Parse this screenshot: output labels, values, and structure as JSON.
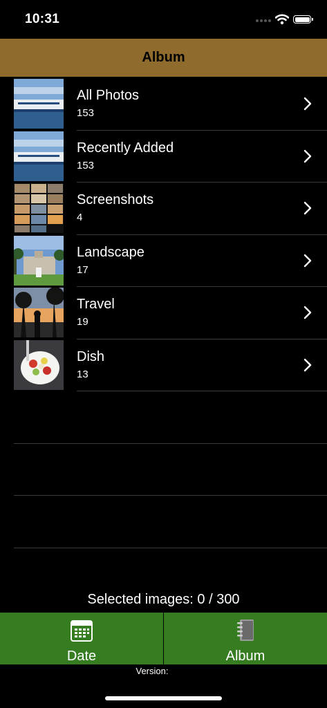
{
  "status_bar": {
    "time": "10:31"
  },
  "nav": {
    "title": "Album"
  },
  "albums": [
    {
      "title": "All Photos",
      "count": "153",
      "thumb": "harbor-boat"
    },
    {
      "title": "Recently Added",
      "count": "153",
      "thumb": "harbor-boat"
    },
    {
      "title": "Screenshots",
      "count": "4",
      "thumb": "collage"
    },
    {
      "title": "Landscape",
      "count": "17",
      "thumb": "palace-lawn"
    },
    {
      "title": "Travel",
      "count": "19",
      "thumb": "palm-sunset"
    },
    {
      "title": "Dish",
      "count": "13",
      "thumb": "fruit-bowl"
    }
  ],
  "selection": {
    "label": "Selected images:  0 / 300"
  },
  "tabs": [
    {
      "label": "Date",
      "icon": "calendar-icon"
    },
    {
      "label": "Album",
      "icon": "notebook-icon"
    }
  ],
  "footer": {
    "version": "Version:"
  },
  "colors": {
    "nav": "#8f6c2e",
    "tab": "#367d22",
    "background": "#000000"
  }
}
